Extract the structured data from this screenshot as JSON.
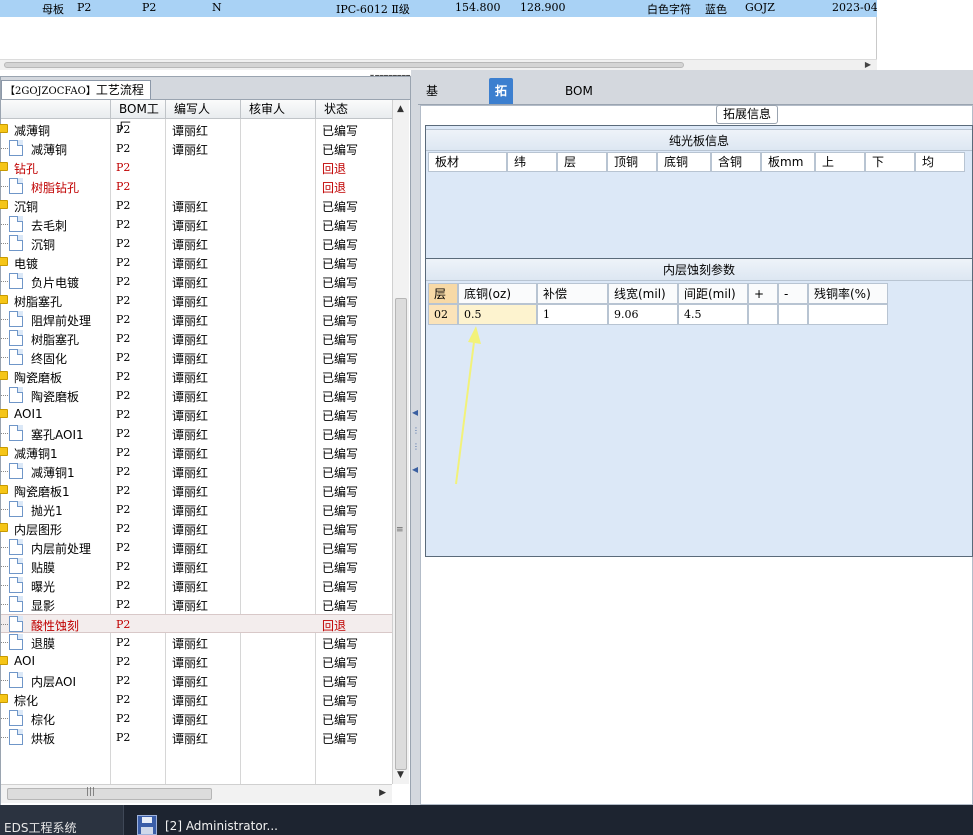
{
  "top_row": {
    "c1": "母板",
    "c2": "P2",
    "c3": "P2",
    "c4": "N",
    "c5": "IPC-6012 Ⅱ级",
    "c6": "154.800",
    "c7": "128.900",
    "c8": "白色字符",
    "c9": "蓝色",
    "c10": "GOJZ",
    "c11": "2023-04-"
  },
  "left_panel": {
    "tab_code": "【2GOJZOCFAO】",
    "tab_label": "工艺流程",
    "columns": [
      "BOM工厂",
      "编写人",
      "核审人",
      "状态"
    ]
  },
  "tree_rows": [
    {
      "level": 0,
      "name": "减薄铜",
      "bom": "P2",
      "author": "谭丽红",
      "status": "已编写",
      "red": false
    },
    {
      "level": 1,
      "name": "减薄铜",
      "bom": "P2",
      "author": "谭丽红",
      "status": "已编写",
      "red": false
    },
    {
      "level": 0,
      "name": "钻孔",
      "bom": "P2",
      "author": "",
      "status": "回退",
      "red": true
    },
    {
      "level": 1,
      "name": "树脂钻孔",
      "bom": "P2",
      "author": "",
      "status": "回退",
      "red": true
    },
    {
      "level": 0,
      "name": "沉铜",
      "bom": "P2",
      "author": "谭丽红",
      "status": "已编写",
      "red": false
    },
    {
      "level": 1,
      "name": "去毛刺",
      "bom": "P2",
      "author": "谭丽红",
      "status": "已编写",
      "red": false
    },
    {
      "level": 1,
      "name": "沉铜",
      "bom": "P2",
      "author": "谭丽红",
      "status": "已编写",
      "red": false
    },
    {
      "level": 0,
      "name": "电镀",
      "bom": "P2",
      "author": "谭丽红",
      "status": "已编写",
      "red": false
    },
    {
      "level": 1,
      "name": "负片电镀",
      "bom": "P2",
      "author": "谭丽红",
      "status": "已编写",
      "red": false
    },
    {
      "level": 0,
      "name": "树脂塞孔",
      "bom": "P2",
      "author": "谭丽红",
      "status": "已编写",
      "red": false
    },
    {
      "level": 1,
      "name": "阻焊前处理",
      "bom": "P2",
      "author": "谭丽红",
      "status": "已编写",
      "red": false
    },
    {
      "level": 1,
      "name": "树脂塞孔",
      "bom": "P2",
      "author": "谭丽红",
      "status": "已编写",
      "red": false
    },
    {
      "level": 1,
      "name": "终固化",
      "bom": "P2",
      "author": "谭丽红",
      "status": "已编写",
      "red": false
    },
    {
      "level": 0,
      "name": "陶瓷磨板",
      "bom": "P2",
      "author": "谭丽红",
      "status": "已编写",
      "red": false
    },
    {
      "level": 1,
      "name": "陶瓷磨板",
      "bom": "P2",
      "author": "谭丽红",
      "status": "已编写",
      "red": false
    },
    {
      "level": 0,
      "name": "AOI1",
      "bom": "P2",
      "author": "谭丽红",
      "status": "已编写",
      "red": false
    },
    {
      "level": 1,
      "name": "塞孔AOI1",
      "bom": "P2",
      "author": "谭丽红",
      "status": "已编写",
      "red": false
    },
    {
      "level": 0,
      "name": "减薄铜1",
      "bom": "P2",
      "author": "谭丽红",
      "status": "已编写",
      "red": false
    },
    {
      "level": 1,
      "name": "减薄铜1",
      "bom": "P2",
      "author": "谭丽红",
      "status": "已编写",
      "red": false
    },
    {
      "level": 0,
      "name": "陶瓷磨板1",
      "bom": "P2",
      "author": "谭丽红",
      "status": "已编写",
      "red": false
    },
    {
      "level": 1,
      "name": "抛光1",
      "bom": "P2",
      "author": "谭丽红",
      "status": "已编写",
      "red": false
    },
    {
      "level": 0,
      "name": "内层图形",
      "bom": "P2",
      "author": "谭丽红",
      "status": "已编写",
      "red": false
    },
    {
      "level": 1,
      "name": "内层前处理",
      "bom": "P2",
      "author": "谭丽红",
      "status": "已编写",
      "red": false
    },
    {
      "level": 1,
      "name": "贴膜",
      "bom": "P2",
      "author": "谭丽红",
      "status": "已编写",
      "red": false
    },
    {
      "level": 1,
      "name": "曝光",
      "bom": "P2",
      "author": "谭丽红",
      "status": "已编写",
      "red": false
    },
    {
      "level": 1,
      "name": "显影",
      "bom": "P2",
      "author": "谭丽红",
      "status": "已编写",
      "red": false
    },
    {
      "level": 1,
      "name": "酸性蚀刻",
      "bom": "P2",
      "author": "",
      "status": "回退",
      "red": true,
      "selected": true
    },
    {
      "level": 1,
      "name": "退膜",
      "bom": "P2",
      "author": "谭丽红",
      "status": "已编写",
      "red": false
    },
    {
      "level": 0,
      "name": "AOI",
      "bom": "P2",
      "author": "谭丽红",
      "status": "已编写",
      "red": false
    },
    {
      "level": 1,
      "name": "内层AOI",
      "bom": "P2",
      "author": "谭丽红",
      "status": "已编写",
      "red": false
    },
    {
      "level": 0,
      "name": "棕化",
      "bom": "P2",
      "author": "谭丽红",
      "status": "已编写",
      "red": false
    },
    {
      "level": 1,
      "name": "棕化",
      "bom": "P2",
      "author": "谭丽红",
      "status": "已编写",
      "red": false
    },
    {
      "level": 1,
      "name": "烘板",
      "bom": "P2",
      "author": "谭丽红",
      "status": "已编写",
      "red": false
    }
  ],
  "right_panel": {
    "tabs": [
      "基本信息",
      "拓展信息",
      "BOM"
    ],
    "active_tab": "拓展信息",
    "group_title": "拓展信息",
    "pure_board": {
      "title": "纯光板信息",
      "columns": [
        "板材",
        "纬",
        "层",
        "顶铜",
        "底铜",
        "含铜",
        "板mm",
        "上",
        "下",
        "均"
      ]
    },
    "inner_etch": {
      "title": "内层蚀刻参数",
      "columns": [
        "层",
        "底铜(oz)",
        "补偿",
        "线宽(mil)",
        "间距(mil)",
        "+",
        "-",
        "残铜率(%)"
      ],
      "rows": [
        [
          "02",
          "0.5",
          "1",
          "9.06",
          "4.5",
          "",
          "",
          ""
        ]
      ]
    }
  },
  "taskbar": {
    "app_label": "EDS工程系统",
    "window_label": "[2] Administrator..."
  },
  "colors": {
    "selected_row": "#a9d2f5",
    "active_tab": "#3c7fcf",
    "returned_status": "#c00000",
    "annotation_arrow": "#f2f27a"
  }
}
